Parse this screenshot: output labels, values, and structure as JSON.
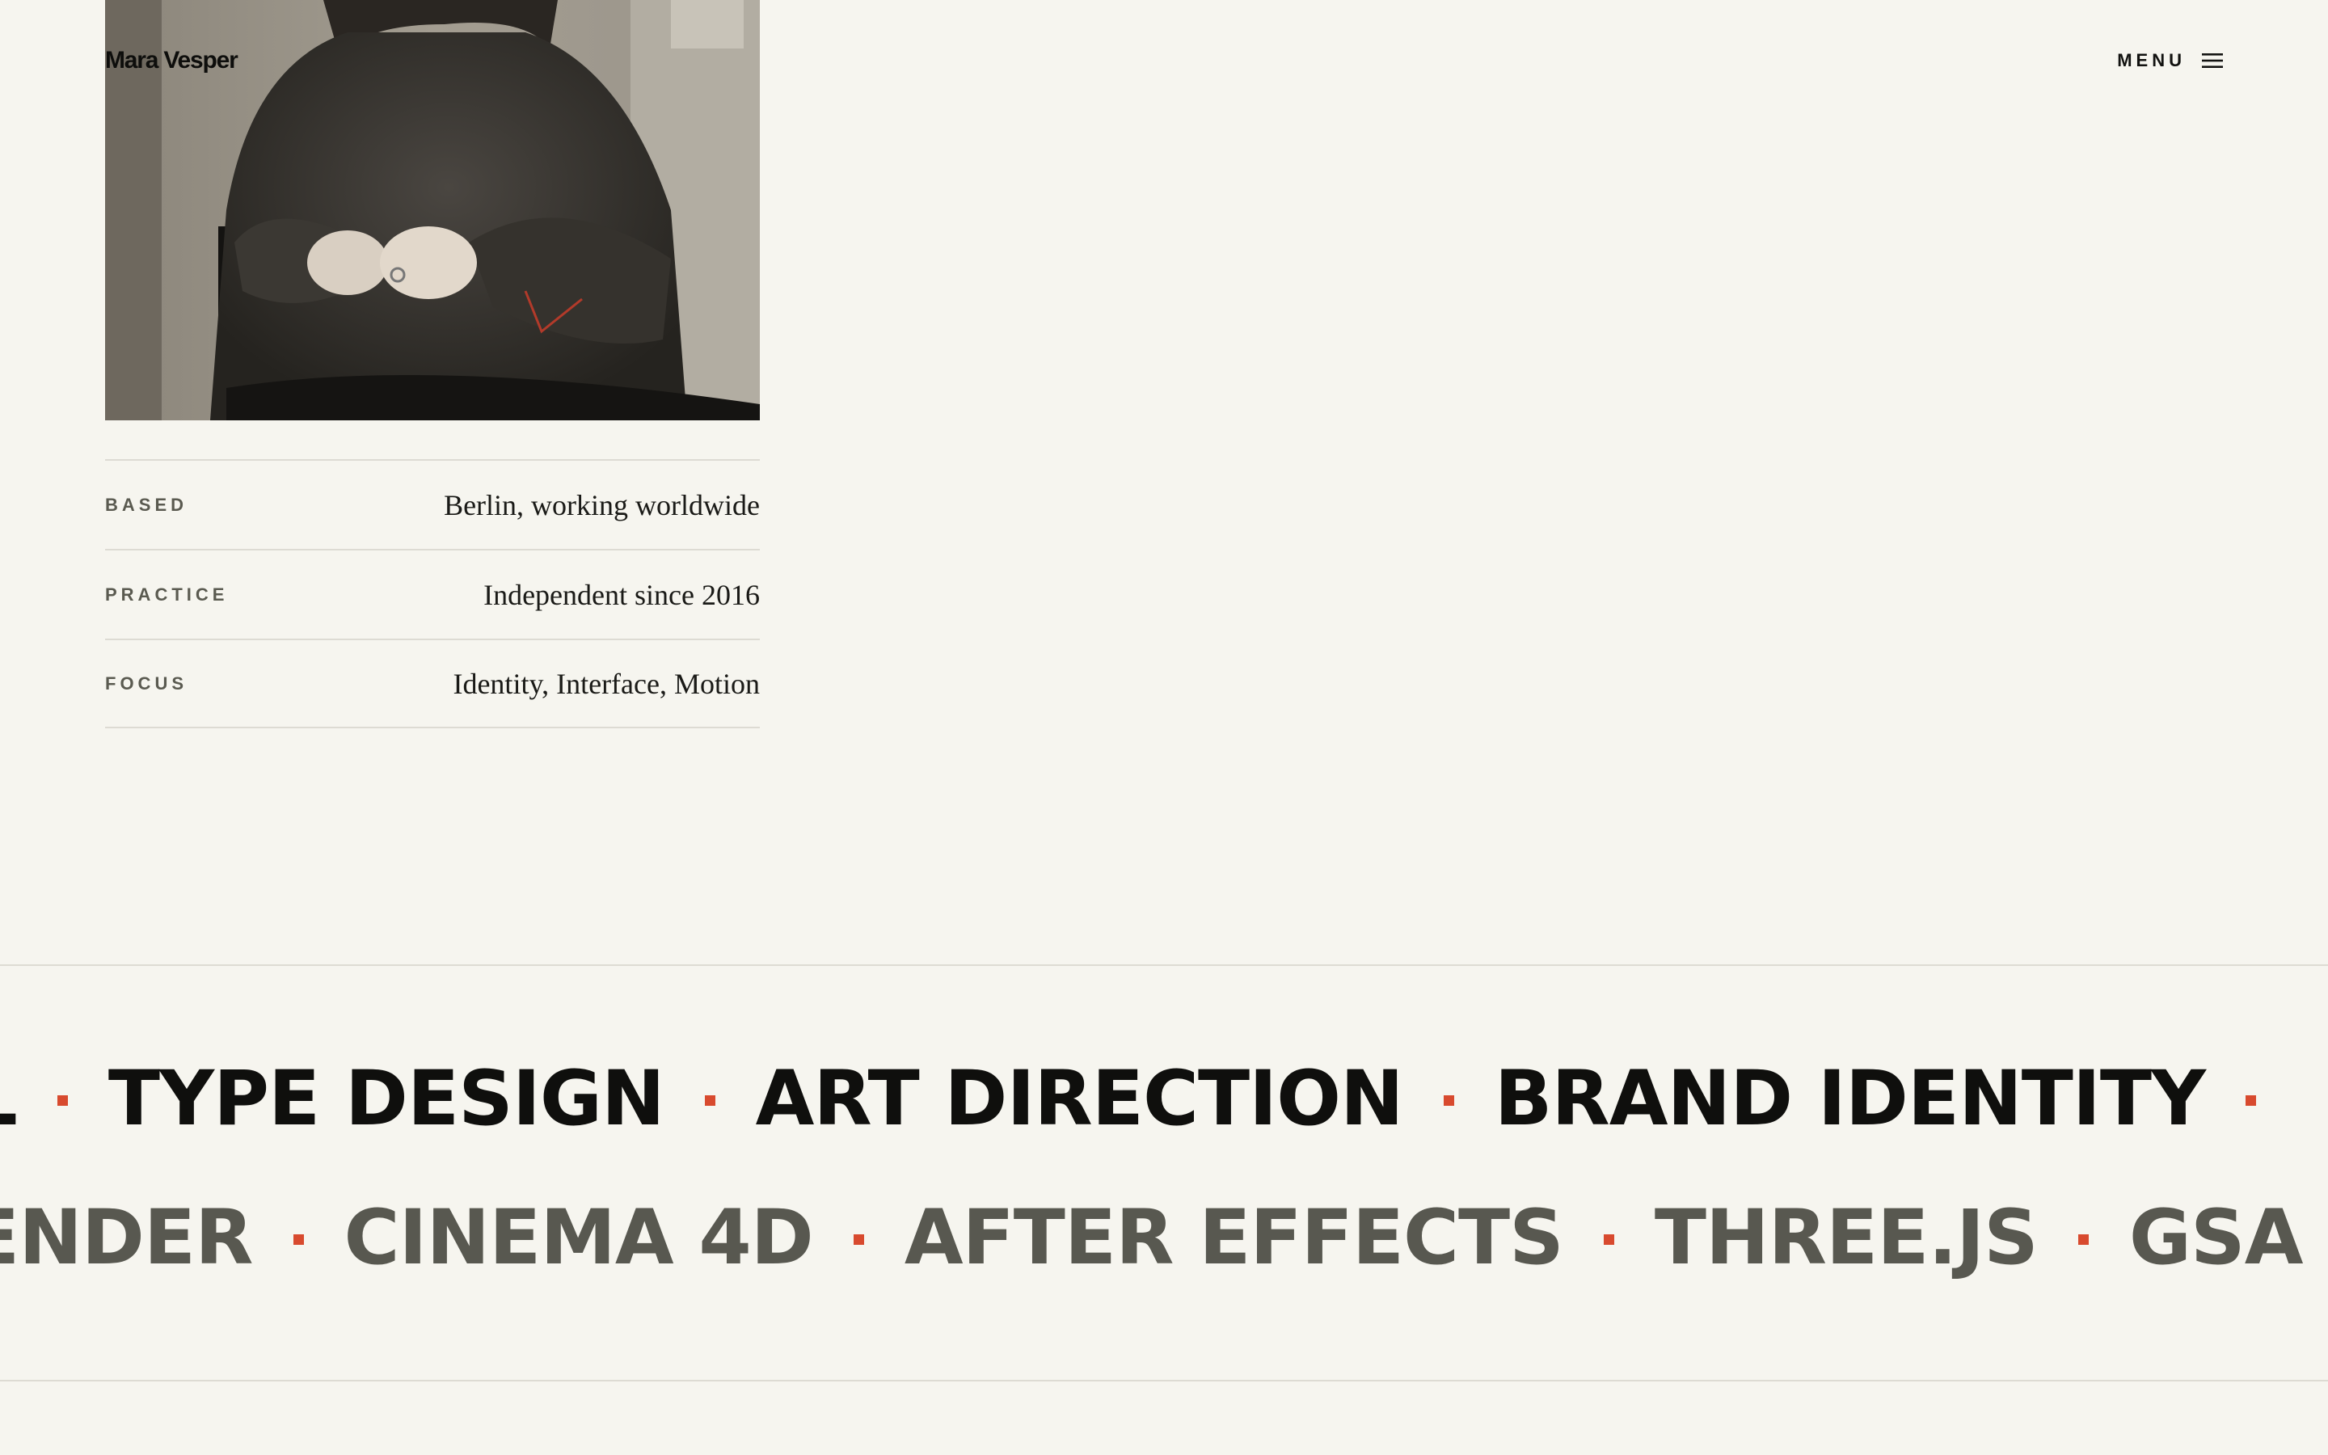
{
  "header": {
    "brand": "Mara Vesper",
    "menu_label": "MENU"
  },
  "portrait": {
    "alt": "Portrait of a person in a dark knit sweater, hands clasped"
  },
  "facts": [
    {
      "label": "BASED",
      "value": "Berlin, working worldwide"
    },
    {
      "label": "PRACTICE",
      "value": "Independent since 2016"
    },
    {
      "label": "FOCUS",
      "value": "Identity, Interface, Motion"
    }
  ],
  "marquee_primary": [
    "L",
    "TYPE DESIGN",
    "ART DIRECTION",
    "BRAND IDENTITY"
  ],
  "marquee_secondary": [
    "ENDER",
    "CINEMA 4D",
    "AFTER EFFECTS",
    "THREE.JS",
    "GSA"
  ],
  "colors": {
    "background": "#f6f5ef",
    "accent": "#d84a2e",
    "ink": "#0f0f0d",
    "muted": "#585850",
    "rule": "#dddbd3"
  }
}
